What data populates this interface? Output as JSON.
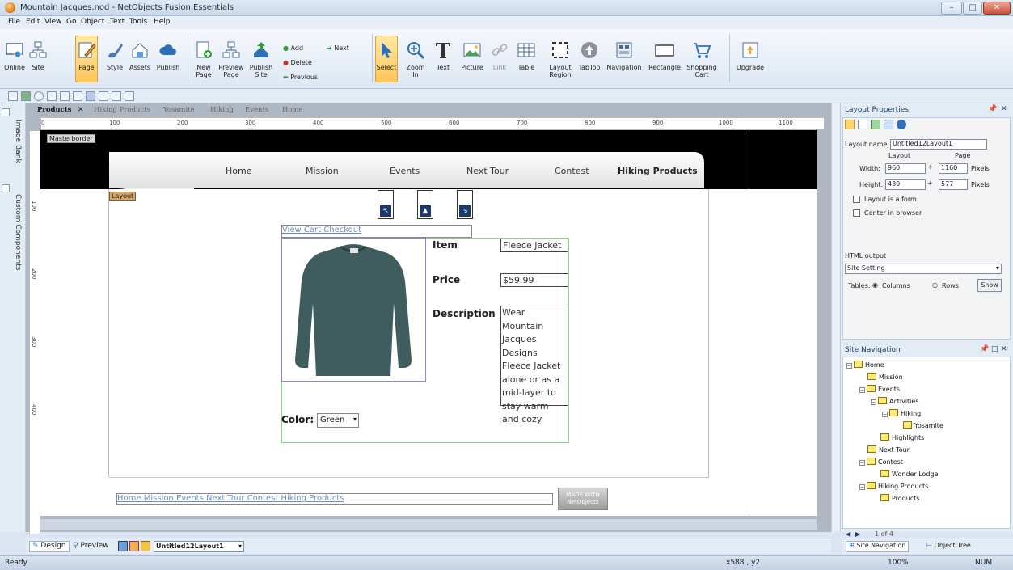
{
  "window": {
    "title": "Mountain Jacques.nod - NetObjects Fusion Essentials",
    "controls": [
      "–",
      "□",
      "✕"
    ]
  },
  "menu": [
    "File",
    "Edit",
    "View",
    "Go",
    "Object",
    "Text",
    "Tools",
    "Help"
  ],
  "ribbon": {
    "online": "Online",
    "site": "Site",
    "page": "Page",
    "style": "Style",
    "assets": "Assets",
    "publish": "Publish",
    "new_page": "New Page",
    "preview_page": "Preview Page",
    "publish_site": "Publish Site",
    "add": "Add",
    "next": "Next",
    "delete": "Delete",
    "previous": "Previous",
    "select": "Select",
    "zoom_in": "Zoom In",
    "text": "Text",
    "picture": "Picture",
    "link": "Link",
    "table": "Table",
    "layout_region": "Layout Region",
    "tabtop": "TabTop",
    "navigation": "Navigation",
    "rectangle": "Rectangle",
    "shopping_cart": "Shopping Cart",
    "upgrade": "Upgrade"
  },
  "left_dock": {
    "image_bank": "Image Bank",
    "custom_components": "Custom Components"
  },
  "doc_tabs": [
    "Products",
    "Hiking Products",
    "Yosamite",
    "Hiking",
    "Events",
    "Home"
  ],
  "ruler": {
    "h": [
      "0",
      "100",
      "200",
      "300",
      "400",
      "500",
      "600",
      "700",
      "800",
      "900",
      "1000",
      "1100"
    ],
    "v": [
      "100",
      "200",
      "300",
      "400"
    ]
  },
  "page": {
    "masterborder_tag": "Masterborder",
    "layout_tag": "Layout",
    "nav": [
      "Home",
      "Mission",
      "Events",
      "Next Tour",
      "Contest",
      "Hiking Products"
    ],
    "cart_links": "View Cart  Checkout",
    "item_label": "Item",
    "item_value": "Fleece Jacket",
    "price_label": "Price",
    "price_value": "$59.99",
    "description_label": "Description",
    "description_value": "Wear Mountain Jacques Designs Fleece Jacket alone or as a mid-layer to stay warm and cozy.",
    "color_label": "Color:",
    "color_value": "Green",
    "footer_links": "Home  Mission  Events  Next Tour  Contest  Hiking Products",
    "made_with": "MADE WITH NetObjects"
  },
  "layout_props": {
    "title": "Layout Properties",
    "layout_name_label": "Layout name:",
    "layout_name_value": "Untitled12Layout1",
    "col_layout": "Layout",
    "col_page": "Page",
    "width_label": "Width:",
    "width_layout": "960",
    "width_page": "1160",
    "height_label": "Height:",
    "height_layout": "430",
    "height_page": "577",
    "pixels": "Pixels",
    "is_form": "Layout is a form",
    "center": "Center in browser",
    "html_output": "HTML output",
    "html_output_value": "Site Setting",
    "tables_label": "Tables:",
    "columns": "Columns",
    "rows": "Rows",
    "show": "Show"
  },
  "site_nav": {
    "title": "Site Navigation",
    "tree": [
      "Home",
      "Mission",
      "Events",
      "Activities",
      "Hiking",
      "Yosamite",
      "Highlights",
      "Next Tour",
      "Contest",
      "Wonder Lodge",
      "Hiking Products",
      "Products"
    ],
    "pager": "1 of 4"
  },
  "bottom": {
    "design": "Design",
    "preview": "Preview",
    "layout_select": "Untitled12Layout1",
    "site_navigation_tab": "Site Navigation",
    "object_tree_tab": "Object Tree"
  },
  "status": {
    "ready": "Ready",
    "coords": "x588 , y2",
    "zoom": "100%",
    "num": "NUM"
  },
  "colors": {
    "accent": "#1d3c66",
    "link": "#6b8fc1",
    "jacket": "#3f5c5e",
    "product_border": "#7be07b"
  }
}
